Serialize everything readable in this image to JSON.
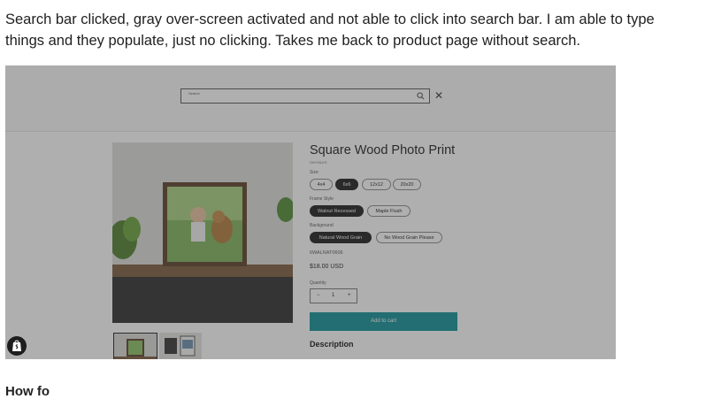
{
  "post": {
    "text": "Search bar clicked, gray over-screen activated and not able to click into search bar. I am able to type things and they populate, just no clicking. Takes me back to product page without search."
  },
  "search": {
    "placeholder": "Search"
  },
  "product": {
    "title": "Square Wood Photo Print",
    "vendor": "SHYSILKS",
    "size_label": "Size",
    "sizes": [
      "4x4",
      "6x6",
      "12x12",
      "20x20"
    ],
    "selected_size": "6x6",
    "frame_label": "Frame Style",
    "frames": [
      "Walnut Recessed",
      "Maple Flush"
    ],
    "selected_frame": "Walnut Recessed",
    "background_label": "Background",
    "backgrounds": [
      "Natural Wood Grain",
      "No Wood Grain Please"
    ],
    "selected_background": "Natural Wood Grain",
    "sku": "6WALNAT0606",
    "price": "$18.00 USD",
    "quantity_label": "Quantity",
    "quantity": "1",
    "minus": "−",
    "plus": "+",
    "add_to_cart": "Add to cart",
    "description_heading": "Description"
  },
  "below_text": "How fo",
  "colors": {
    "overlay": "#404040",
    "cart_button": "#0d8f96",
    "selected_pill": "#1a1a1a"
  }
}
